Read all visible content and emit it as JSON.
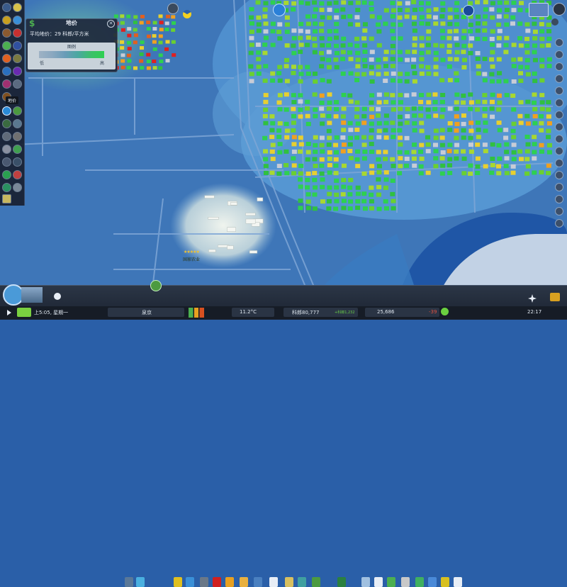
{
  "land_value_panel": {
    "title": "地价",
    "currency_icon": "$",
    "average_label": "平均地价：29 科郎/平方米",
    "legend_title": "图例",
    "legend_low": "低",
    "legend_high": "高",
    "close_label": "✕"
  },
  "left_toolbar": {
    "tooltip": "地价"
  },
  "map": {
    "landmark_label": "国家农业",
    "landmark_stars": "★★★★★"
  },
  "bottom_info": {
    "date": "上5:05, 星期一",
    "city_name": "泉京",
    "temperature": "11.2°C",
    "money": "科郎80,777",
    "income": "+科郎1,232",
    "population": "25,686",
    "population_change": "-39",
    "clock": "22:17"
  },
  "colors": {
    "water": "#2a5fa8",
    "land_low": "#4c82c2",
    "building_high": "#2ed050",
    "building_mid": "#e8d030",
    "building_low": "#e02020",
    "panel_bg": "#1e283c"
  }
}
